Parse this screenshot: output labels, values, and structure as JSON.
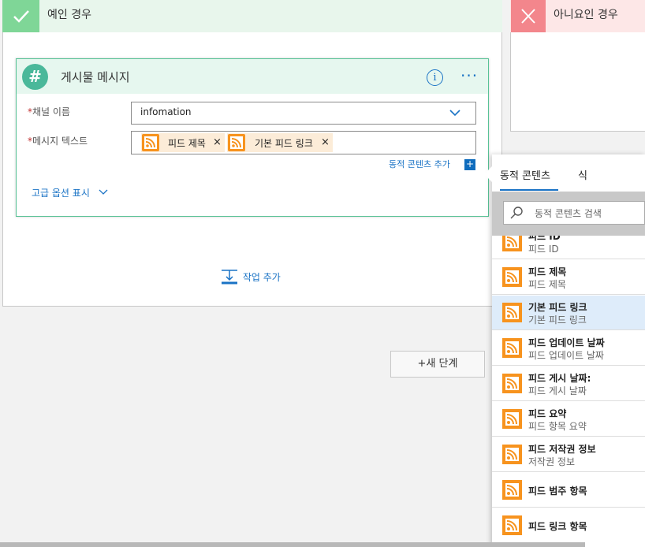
{
  "yes_branch": {
    "title": "예인 경우"
  },
  "no_branch": {
    "title": "아니요인 경우"
  },
  "card": {
    "title": "게시물 메시지",
    "channel": {
      "required_mark": "*",
      "label": "채널 이름",
      "value": "infomation"
    },
    "message": {
      "required_mark": "*",
      "label": "메시지 텍스트",
      "tokens": [
        {
          "label": "피드 제목",
          "remove": "×"
        },
        {
          "label": "기본 피드 링크",
          "remove": "×"
        }
      ]
    },
    "add_dynamic_content": "동적 콘텐츠 추가",
    "advanced_options": "고급 옵션 표시"
  },
  "add_action": "작업 추가",
  "new_step": "+새 단계",
  "dynamic_panel": {
    "tabs": [
      "동적 콘텐츠",
      "식"
    ],
    "search_placeholder": "동적 콘텐츠 검색",
    "items": [
      {
        "title": "피드 ID",
        "subtitle": "피드 ID"
      },
      {
        "title": "피드 제목",
        "subtitle": "피드 제목"
      },
      {
        "title": "기본 피드 링크",
        "subtitle": "기본 피드 링크",
        "selected": true
      },
      {
        "title": "피드 업데이트 날짜",
        "subtitle": "피드 업데이트 날짜"
      },
      {
        "title": "피드 게시 날짜:",
        "subtitle": "피드 게시 날짜"
      },
      {
        "title": "피드 요약",
        "subtitle": "피드 항목 요약"
      },
      {
        "title": "피드 저작권 정보",
        "subtitle": "저작권 정보"
      },
      {
        "title": "피드 범주 항목",
        "subtitle": ""
      },
      {
        "title": "피드 링크 항목",
        "subtitle": ""
      }
    ]
  },
  "colors": {
    "accent": "#1a73c5",
    "rss": "#f7931e",
    "yes": "#7fd697",
    "no": "#f3868c",
    "card_border": "#58c296"
  }
}
